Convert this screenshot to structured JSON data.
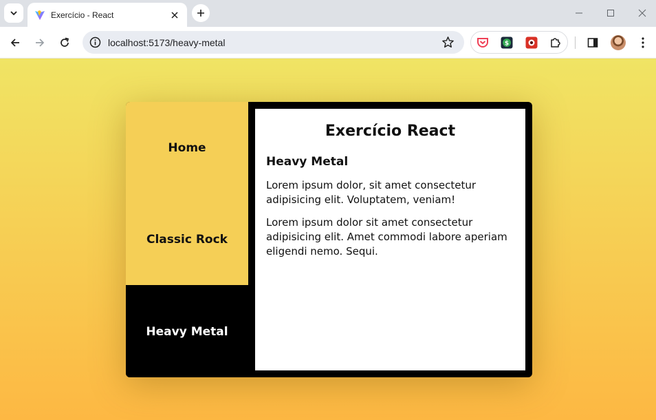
{
  "browser": {
    "tab": {
      "title": "Exercício - React"
    },
    "address_bar": {
      "url": "localhost:5173/heavy-metal"
    }
  },
  "page": {
    "nav": [
      {
        "label": "Home",
        "active": false
      },
      {
        "label": "Classic Rock",
        "active": false
      },
      {
        "label": "Heavy Metal",
        "active": true
      }
    ],
    "title": "Exercício React",
    "section_heading": "Heavy Metal",
    "paragraphs": [
      "Lorem ipsum dolor, sit amet consectetur adipisicing elit. Voluptatem, veniam!",
      "Lorem ipsum dolor sit amet consectetur adipisicing elit. Amet commodi labore aperiam eligendi nemo. Sequi."
    ]
  },
  "colors": {
    "background_top": "#f0e464",
    "background_bottom": "#fdb843",
    "nav_light": "#f5cf56",
    "nav_active": "#000000"
  },
  "icons": [
    "tab-search-icon",
    "vite-favicon-icon",
    "close-icon",
    "plus-icon",
    "minimize-icon",
    "maximize-icon",
    "window-close-icon",
    "back-arrow-icon",
    "forward-arrow-icon",
    "reload-icon",
    "site-info-icon",
    "star-icon",
    "pocket-icon",
    "dollar-extension-icon",
    "red-extension-icon",
    "extensions-puzzle-icon",
    "side-panel-icon",
    "avatar",
    "kebab-menu-icon"
  ]
}
